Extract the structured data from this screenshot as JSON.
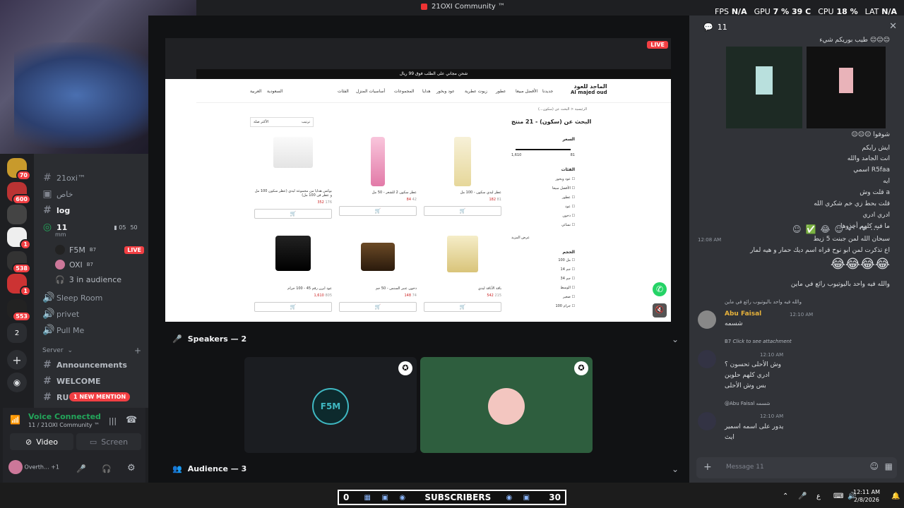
{
  "window": {
    "title": "21OXI Community ™"
  },
  "stats": {
    "fps_label": "FPS",
    "fps": "N/A",
    "gpu_label": "GPU",
    "gpu": "7 %",
    "gpu_temp": "39 C",
    "cpu_label": "CPU",
    "cpu": "18 %",
    "lat_label": "LAT",
    "lat": "N/A"
  },
  "servers": [
    {
      "badge": "70"
    },
    {
      "badge": "600"
    },
    {
      "badge": "1"
    },
    {
      "badge": "538"
    },
    {
      "badge": "1"
    },
    {
      "badge": "553"
    },
    {
      "badge": "2"
    }
  ],
  "channels": {
    "items": [
      {
        "name": "21oxi™"
      },
      {
        "name": "خاص"
      },
      {
        "name": "log"
      },
      {
        "name": "11",
        "sub": "mm",
        "users": "05",
        "limit": "50"
      }
    ],
    "voice_users": [
      {
        "name": "F5M",
        "tag": "B7",
        "live": "LIVE"
      },
      {
        "name": "OXI",
        "tag": "B7"
      }
    ],
    "audience": "3 in audience",
    "more": [
      {
        "name": "Sleep Room"
      },
      {
        "name": "privet"
      },
      {
        "name": "Pull Me"
      }
    ],
    "category": "Server",
    "category_items": [
      {
        "name": "Announcements"
      },
      {
        "name": "WELCOME"
      },
      {
        "name": "RU"
      }
    ],
    "new_mention": "1 NEW MENTION"
  },
  "voice_panel": {
    "status": "Voice Connected",
    "server": "11 / 21OXI Community ™",
    "video": "Video",
    "screen": "Screen",
    "user": "Overth... +1"
  },
  "stage": {
    "live": "LIVE",
    "speakers": "Speakers — 2",
    "audience": "Audience — 3",
    "tile_label": "F5M"
  },
  "shop": {
    "banner": "شحن مجاني على الطلب فوق 99 ريال",
    "brand_ar": "الماجد للعود",
    "brand_en": "Al majed oud",
    "nav": [
      "جديدنا",
      "الأفضل مبيعا",
      "عطور",
      "زيوت عطرية",
      "عود وبخور",
      "هدايا",
      "المجموعات",
      "أساسيات المنزل",
      "الفئات"
    ],
    "lang": "العربية",
    "country": "السعودية",
    "breadcrumb": "الرئيسية < البحث عن (سكون...)",
    "search_title": "البحث عن (سكون) - 21 منتج",
    "sort_label": "ترتيب",
    "sort_value": "الأكثر صلة",
    "price_filter": "السعر",
    "price_min": "1,610",
    "price_max": "81",
    "categories_title": "الفئات",
    "categories": [
      "عود وبخور",
      "الأفضل مبيعا",
      "عطور",
      "عود",
      "دخون",
      "نسائي"
    ],
    "show_more": "عرض المزيد",
    "size_title": "الحجم",
    "sizes": [
      "100 مل",
      "14 جم",
      "34 جم",
      "الوسط",
      "صغير",
      "100 جرام"
    ],
    "products": [
      {
        "name": "عطر ليدي سكون - 100 مل",
        "price": "182",
        "old": "81"
      },
      {
        "name": "عطر سكون 2 للشعر - 50 مل",
        "price": "84",
        "old": "42"
      },
      {
        "name": "بوكس هدايا من مجموعة ليدي (عطر سكون 100 مل و عطر فن 100 مل)",
        "price": "352",
        "old": "176"
      },
      {
        "name": "باقة الأناقة ليدي",
        "price": "542",
        "old": "215"
      },
      {
        "name": "دخون عنبر السنس - 50 جم",
        "price": "148",
        "old": "74"
      },
      {
        "name": "عود ايرن رقم 45 - 100 جرام",
        "price": "1,610",
        "old": "805"
      }
    ]
  },
  "chat": {
    "channel": "11",
    "messages": [
      {
        "text": "طيب بوريكم شيء 😑😑😑"
      },
      {
        "text": "😑😑😑 شوفوا"
      },
      {
        "text": "ايش رايكم"
      },
      {
        "text": "انت الجامد والله"
      },
      {
        "text": "اسمي R5faa"
      },
      {
        "text": "ايه"
      },
      {
        "text": "قلت وش a"
      },
      {
        "text": "قلت بحط زي خم شكري الله"
      },
      {
        "text": "ادري ادري"
      },
      {
        "text": "ما فيه كلهم أخذوها"
      },
      {
        "text": "سبحان الله لمن جبنت 5 زيط"
      },
      {
        "text": "اع تذكرت لمن ابو نوح قراه اسم ديك حمار و هيه لمار"
      },
      {
        "text": "😂😂😂😂"
      },
      {
        "text": "والله فيه واحد باليوتيوب رائع في ماين"
      }
    ],
    "time1": "12:08 AM",
    "reply1": "والله فيه واحد باليوتيوب رائع في ماين",
    "user1": "Abu Faisal",
    "time2": "12:10 AM",
    "msg_user1": "شسمه",
    "attachment": "Click to see attachment",
    "tag": "B7",
    "time3": "12:10 AM",
    "group2": [
      "وش الأحلى تحسون ؟",
      "ادري كلهم حلوين",
      "بس وش الأحلى"
    ],
    "mention_reply": "@Abu Faisal شسمه",
    "time4": "12:10 AM",
    "group3": [
      "يدور على اسمه اسمير",
      "ايث"
    ],
    "input_placeholder": "Message 11"
  },
  "taskbar": {
    "left_count": "0",
    "subs_label": "SUBSCRIBERS",
    "subs_count": "30",
    "lang": "ع",
    "time": "12:11 AM",
    "date": "2/8/2026"
  }
}
